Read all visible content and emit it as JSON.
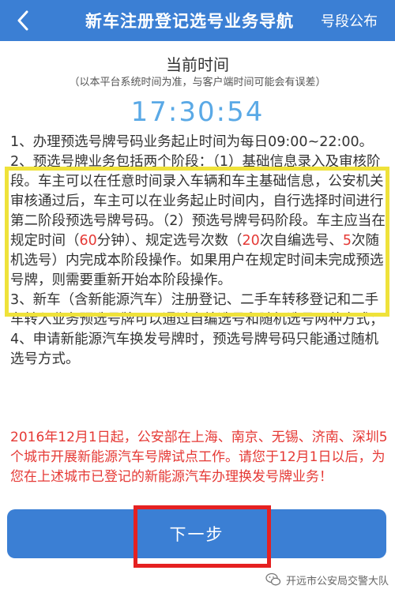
{
  "header": {
    "title": "新车注册登记选号业务导航",
    "right_link": "号段公布",
    "back_icon": "chevron-left-icon"
  },
  "time_section": {
    "title": "当前时间",
    "note": "（以本平台系统时间为准，与客户端时间可能会有误差）",
    "clock": "17:30:54"
  },
  "rules": {
    "r1": "1、办理预选号牌号码业务起止时间为每日09:00~22:00。",
    "r2_p1": "2、预选号牌业务包括两个阶段：（1）基础信息录入及审核阶段。车主可以在任意时间录入车辆和车主基础信息，公安机关审核通过后，车主可以在业务起止时间内，自行选择时间进行第二阶段预选号牌号码。（2）预选号牌号码阶段。车主应当在规定时间（",
    "r2_minutes": "60",
    "r2_p2": "分钟）、规定选号次数（",
    "r2_self": "20",
    "r2_p3": "次自编选号、",
    "r2_random": "5",
    "r2_p4": "次随机选号）内完成本阶段操作。如果用户在规定时间未完成预选号牌，则需要重新开始本阶段操作。",
    "r3": "3、新车（含新能源汽车）注册登记、二手车转移登记和二手车转入业务预选号牌可以通过自编选号和随机选号两种方式；",
    "r4": "4、申请新能源汽车换发号牌时，预选号牌号码只能通过随机选号方式。"
  },
  "announcement": "2016年12月1日起，公安部在上海、南京、无锡、济南、深圳5个城市开展新能源汽车号牌试点工作。请您于12月1日以后，为您在上述城市已登记的新能源汽车办理换发号牌业务！",
  "footer": {
    "next_button": "下一步"
  },
  "watermark": {
    "text": "开远市公安局交警大队",
    "icon": "wechat-icon"
  },
  "colors": {
    "brand_blue": "#3b7fd4",
    "clock_blue": "#5aa9e6",
    "alert_red": "#e53935",
    "annotation_yellow": "#efe23a",
    "annotation_red": "#e52121"
  }
}
